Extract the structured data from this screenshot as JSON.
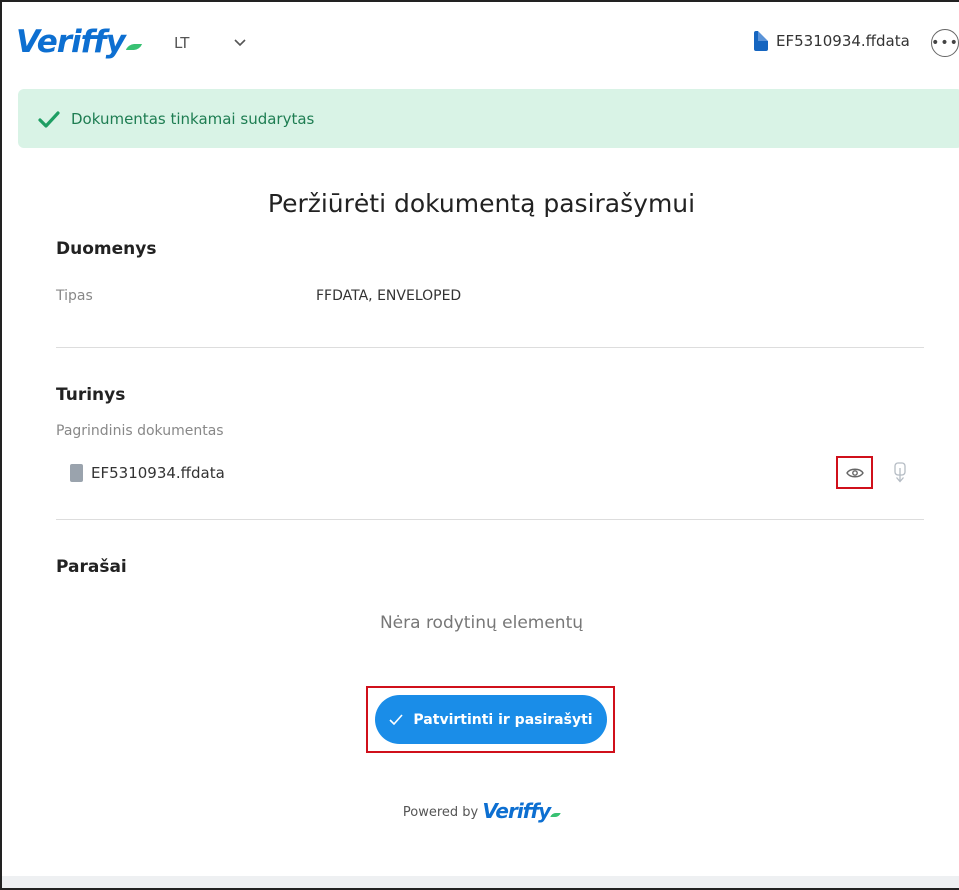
{
  "header": {
    "logo_text": "Veriffy",
    "language": "LT",
    "file_name": "EF5310934.ffdata"
  },
  "alert": {
    "text": "Dokumentas tinkamai sudarytas",
    "color": "#1e7d52"
  },
  "page": {
    "title": "Peržiūrėti dokumentą pasirašymui"
  },
  "details": {
    "section_title": "Duomenys",
    "type_label": "Tipas",
    "type_value": "FFDATA, ENVELOPED"
  },
  "contents": {
    "section_title": "Turinys",
    "main_doc_label": "Pagrindinis dokumentas",
    "file_name": "EF5310934.ffdata"
  },
  "signatures": {
    "section_title": "Parašai",
    "empty_text": "Nėra rodytinų elementų"
  },
  "actions": {
    "sign_button": "Patvirtinti ir pasirašyti"
  },
  "footer": {
    "powered_by": "Powered by",
    "logo_text": "Veriffy"
  },
  "colors": {
    "brand": "#0d6fd1",
    "primary_button": "#1a8de8",
    "alert_bg": "#d9f3e6",
    "highlight": "#d0101b"
  },
  "icons": {
    "alert": "check-icon",
    "lang": "chevron-down-icon",
    "more": "more-horizontal-icon",
    "view": "eye-icon",
    "download": "download-icon",
    "file": "document-icon"
  }
}
